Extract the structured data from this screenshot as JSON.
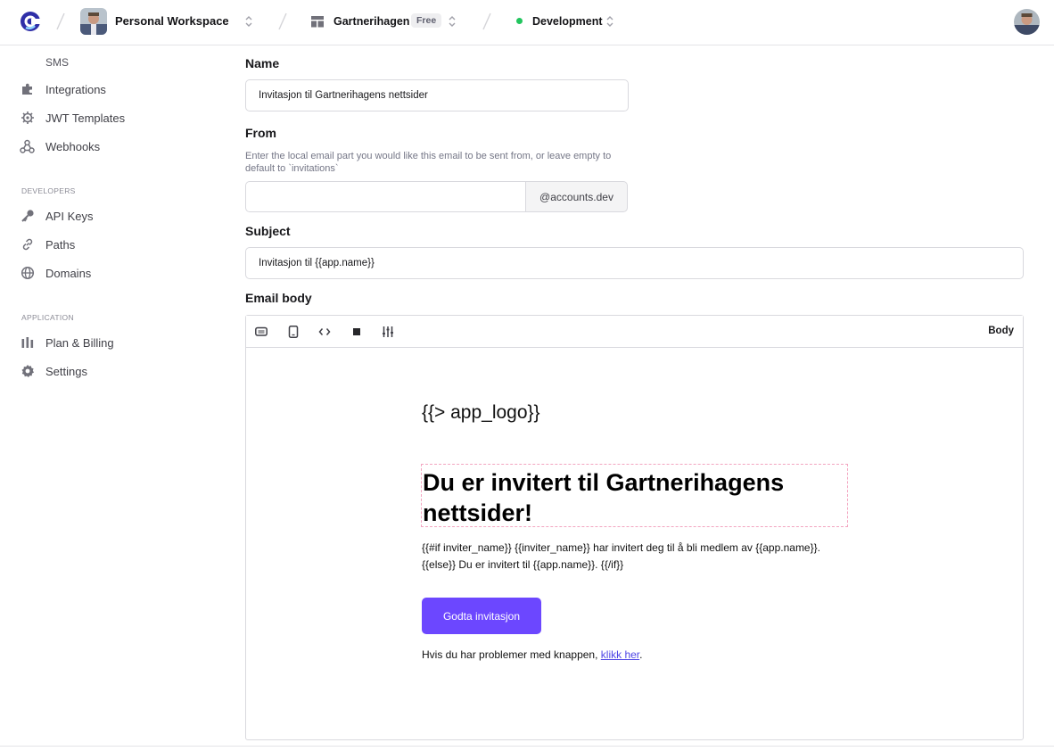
{
  "topbar": {
    "workspace_name": "Personal Workspace",
    "app_name": "Gartnerihagen",
    "plan_badge": "Free",
    "environment": "Development",
    "env_color": "#22c55e"
  },
  "sidebar": {
    "sms_label": "SMS",
    "items_top": [
      {
        "label": "Integrations",
        "icon": "puzzle-icon"
      },
      {
        "label": "JWT Templates",
        "icon": "gear-outline-icon"
      },
      {
        "label": "Webhooks",
        "icon": "webhook-icon"
      }
    ],
    "developers_title": "DEVELOPERS",
    "items_dev": [
      {
        "label": "API Keys",
        "icon": "key-icon"
      },
      {
        "label": "Paths",
        "icon": "link-icon"
      },
      {
        "label": "Domains",
        "icon": "globe-icon"
      }
    ],
    "application_title": "APPLICATION",
    "items_app": [
      {
        "label": "Plan & Billing",
        "icon": "billing-icon"
      },
      {
        "label": "Settings",
        "icon": "gear-icon"
      }
    ]
  },
  "form": {
    "name_label": "Name",
    "name_value": "Invitasjon til Gartnerihagens nettsider",
    "from_label": "From",
    "from_hint": "Enter the local email part you would like this email to be sent from, or leave empty to default to `invitations`",
    "from_value": "",
    "from_domain": "@accounts.dev",
    "subject_label": "Subject",
    "subject_value": "Invitasjon til {{app.name}}",
    "body_label": "Email body"
  },
  "editor": {
    "toolbar_label": "Body",
    "tools": [
      "desktop-preview-icon",
      "mobile-preview-icon",
      "code-icon",
      "square-icon",
      "sliders-icon"
    ],
    "email": {
      "logo": "{{> app_logo}}",
      "heading": "Du er invitert til Gartnerihagens nettsider!",
      "body_line1": "{{#if inviter_name}} {{inviter_name}} har invitert deg til å bli medlem av {{app.name}}.",
      "body_line2": "{{else}} Du er invitert til {{app.name}}. {{/if}}",
      "button": "Godta invitasjon",
      "footer_text": "Hvis du har problemer med knappen, ",
      "footer_link": "klikk her",
      "footer_end": ".",
      "button_color": "#6c47ff"
    }
  }
}
